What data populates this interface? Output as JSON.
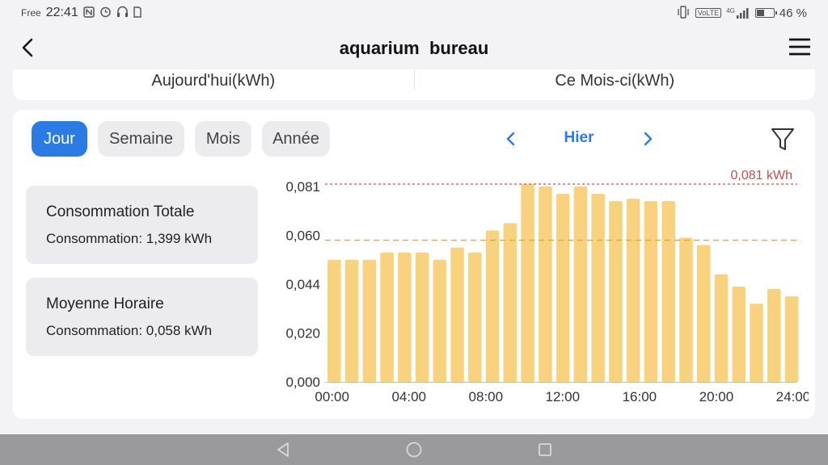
{
  "status_bar": {
    "carrier": "Free",
    "time": "22:41",
    "battery_percent": "46 %",
    "battery_level": 0.46,
    "icons_left": [
      "nfc-icon",
      "alarm-icon",
      "headphones-icon",
      "sim-icon"
    ],
    "icons_right": [
      "vibrate-icon",
      "volte-icon",
      "signal-icon",
      "battery-icon"
    ],
    "volte_text": "VoLTE",
    "network_text": "4G"
  },
  "header": {
    "title": "aquarium  bureau"
  },
  "summary": {
    "today_label": "Aujourd'hui(kWh)",
    "month_label": "Ce Mois-ci(kWh)"
  },
  "tabs": [
    {
      "label": "Jour",
      "active": true
    },
    {
      "label": "Semaine",
      "active": false
    },
    {
      "label": "Mois",
      "active": false
    },
    {
      "label": "Année",
      "active": false
    }
  ],
  "date_nav": {
    "label": "Hier"
  },
  "stats": {
    "total": {
      "title": "Consommation Totale",
      "value": "Consommation: 1,399 kWh"
    },
    "average": {
      "title": "Moyenne Horaire",
      "value": "Consommation: 0,058 kWh"
    }
  },
  "colors": {
    "accent": "#2a7be4",
    "bar": "#f8d27e",
    "max_line": "#c0504d",
    "avg_line": "#d6b11a"
  },
  "chart_data": {
    "type": "bar",
    "x": [
      0,
      1,
      2,
      3,
      4,
      5,
      6,
      7,
      8,
      9,
      10,
      11,
      12,
      13,
      14,
      15,
      16,
      17,
      18,
      19,
      20,
      21,
      22,
      23
    ],
    "values": [
      0.05,
      0.05,
      0.05,
      0.053,
      0.053,
      0.053,
      0.05,
      0.055,
      0.053,
      0.062,
      0.065,
      0.081,
      0.08,
      0.077,
      0.08,
      0.077,
      0.074,
      0.075,
      0.074,
      0.074,
      0.059,
      0.056,
      0.044,
      0.039,
      0.032,
      0.038,
      0.035
    ],
    "y_ticks": [
      "0,000",
      "0,020",
      "0,044",
      "0,060",
      "0,081"
    ],
    "y_tick_values": [
      0.0,
      0.02,
      0.04,
      0.06,
      0.08
    ],
    "x_ticks": [
      "00:00",
      "04:00",
      "08:00",
      "12:00",
      "16:00",
      "20:00",
      "24:00"
    ],
    "ylim": [
      0,
      0.081
    ],
    "xlim": [
      0,
      25
    ],
    "max_value": 0.081,
    "max_label": "0,081 kWh",
    "avg_value": 0.058,
    "grid": false
  }
}
